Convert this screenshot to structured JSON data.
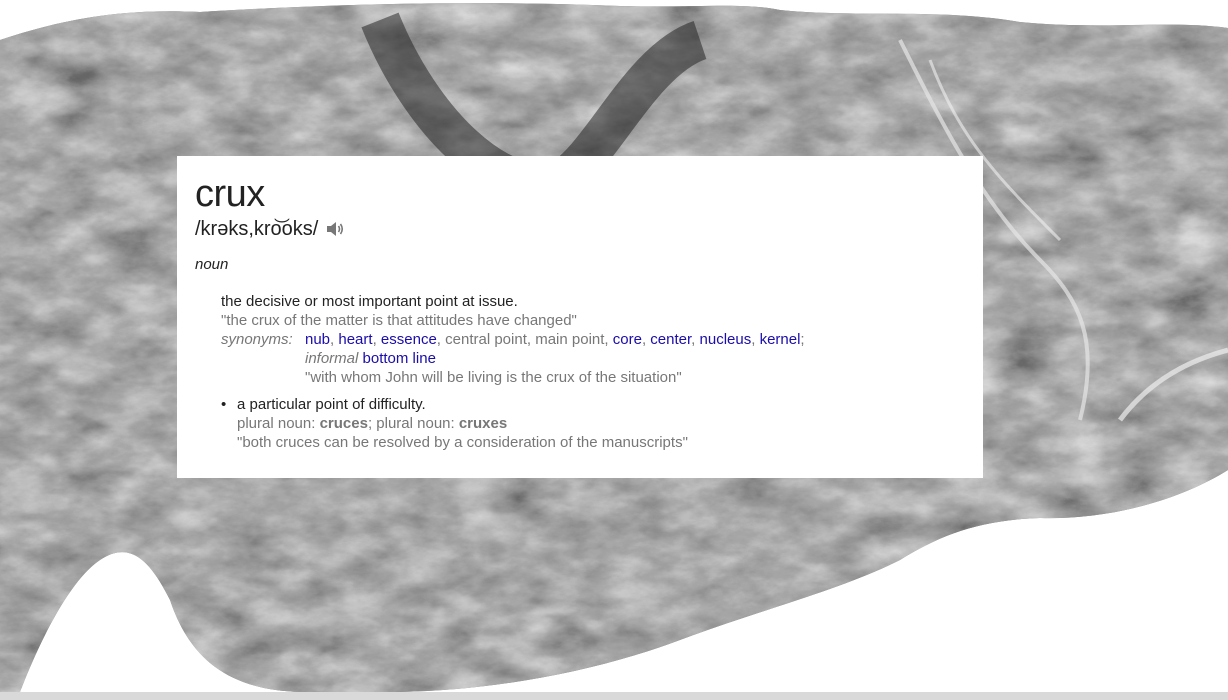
{
  "entry": {
    "word": "crux",
    "pronunciation": "/krəks,kro͝oks/",
    "part_of_speech": "noun",
    "senses": [
      {
        "definition": "the decisive or most important point at issue.",
        "example": "\"the crux of the matter is that attitudes have changed\"",
        "synonyms_label": "synonyms:",
        "synonyms": [
          {
            "text": "nub",
            "link": true,
            "sep": ", "
          },
          {
            "text": "heart",
            "link": true,
            "sep": ", "
          },
          {
            "text": "essence",
            "link": true,
            "sep": ", "
          },
          {
            "text": "central point",
            "link": false,
            "sep": ", "
          },
          {
            "text": "main point",
            "link": false,
            "sep": ", "
          },
          {
            "text": "core",
            "link": true,
            "sep": ", "
          },
          {
            "text": "center",
            "link": true,
            "sep": ", "
          },
          {
            "text": "nucleus",
            "link": true,
            "sep": ", "
          },
          {
            "text": "kernel",
            "link": true,
            "sep": ";"
          }
        ],
        "informal_label": "informal",
        "informal_synonym": "bottom line",
        "synonym_example": "\"with whom John will be living is the crux of the situation\""
      }
    ],
    "sub_sense": {
      "bullet": "•",
      "definition": "a particular point of difficulty.",
      "plural_label_1": "plural noun: ",
      "plural_1": "cruces",
      "plural_sep": "; ",
      "plural_label_2": "plural noun: ",
      "plural_2": "cruxes",
      "example": "\"both cruces can be resolved by a consideration of the manuscripts\""
    }
  },
  "colors": {
    "link": "#1a0dab",
    "grey_text": "#777777",
    "main_text": "#222222",
    "card_bg": "#ffffff"
  },
  "icons": {
    "speaker": "speaker-icon"
  }
}
